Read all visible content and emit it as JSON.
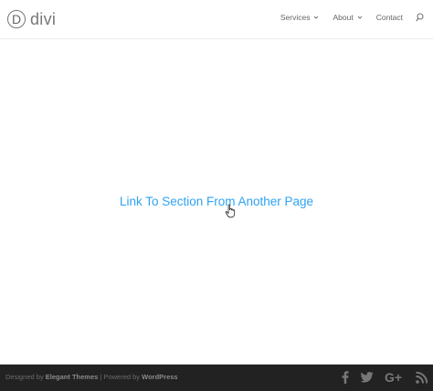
{
  "header": {
    "logo_letter": "D",
    "logo_text": "divi",
    "nav": [
      {
        "label": "Services"
      },
      {
        "label": "About"
      },
      {
        "label": "Contact"
      }
    ]
  },
  "main": {
    "link_text": "Link To Section From Another Page"
  },
  "footer": {
    "designed_by": "Designed by",
    "elegant_themes": "Elegant Themes",
    "powered_by": " | Powered by ",
    "wordpress": "WordPress",
    "social": [
      "facebook-icon",
      "twitter-icon",
      "google-plus-icon",
      "rss-icon"
    ]
  },
  "colors": {
    "link": "#2ea3f2",
    "footer_bg": "#222222",
    "nav_text": "#666666"
  }
}
